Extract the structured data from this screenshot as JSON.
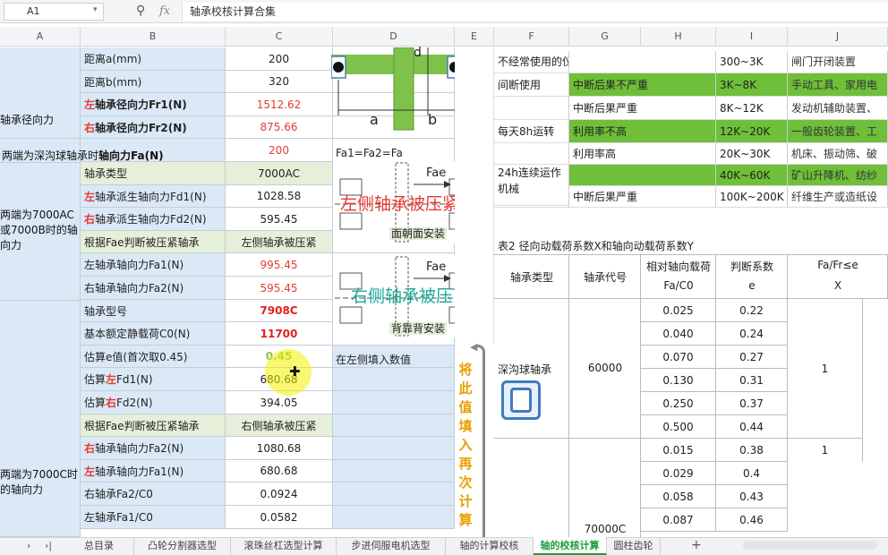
{
  "formula_bar": {
    "cell_ref": "A1",
    "fx": "fx",
    "content": "轴承校核计算合集"
  },
  "columns": [
    "A",
    "B",
    "C",
    "D",
    "E",
    "F",
    "G",
    "H",
    "I",
    "J"
  ],
  "left": {
    "a_labels": [
      "轴承径向力",
      "两端为深沟球轴承时轴向力Fa(N)",
      "两端为7000AC或7000B时的轴向力",
      "两端为7000C时的轴向力"
    ],
    "rows": [
      {
        "label_pre": "",
        "label_accent": "",
        "label_post": "距离a(mm)",
        "value": "200"
      },
      {
        "label_pre": "",
        "label_accent": "",
        "label_post": "距离b(mm)",
        "value": "320"
      },
      {
        "label_pre": "",
        "label_accent": "左",
        "label_post": "轴承径向力Fr1(N)",
        "value": "1512.62"
      },
      {
        "label_pre": "",
        "label_accent": "右",
        "label_post": "轴承径向力Fr2(N)",
        "value": "875.66"
      },
      {
        "label_pre": "",
        "label_accent": "",
        "label_post": "",
        "value": "200"
      },
      {
        "label_pre": "",
        "label_accent": "",
        "label_post": "轴承类型",
        "value": "7000AC"
      },
      {
        "label_pre": "",
        "label_accent": "左",
        "label_post": "轴承派生轴向力Fd1(N)",
        "value": "1028.58"
      },
      {
        "label_pre": "",
        "label_accent": "右",
        "label_post": "轴承派生轴向力Fd2(N)",
        "value": "595.45"
      },
      {
        "label_pre": "",
        "label_accent": "",
        "label_post": "根据Fae判断被压紧轴承",
        "value": "左侧轴承被压紧"
      },
      {
        "label_pre": "",
        "label_accent": "",
        "label_post": "左轴承轴向力Fa1(N)",
        "value": "995.45"
      },
      {
        "label_pre": "",
        "label_accent": "",
        "label_post": "右轴承轴向力Fa2(N)",
        "value": "595.45"
      },
      {
        "label_pre": "",
        "label_accent": "",
        "label_post": "轴承型号",
        "value": "7908C"
      },
      {
        "label_pre": "",
        "label_accent": "",
        "label_post": "基本额定静载荷C0(N)",
        "value": "11700"
      },
      {
        "label_pre": "",
        "label_accent": "",
        "label_post": "估算e值(首次取0.45)",
        "value": "0.45"
      },
      {
        "label_pre": "估算",
        "label_accent": "左",
        "label_post": "Fd1(N)",
        "value": "680.68"
      },
      {
        "label_pre": "估算",
        "label_accent": "右",
        "label_post": "Fd2(N)",
        "value": "394.05"
      },
      {
        "label_pre": "",
        "label_accent": "",
        "label_post": "根据Fae判断被压紧轴承",
        "value": "右侧轴承被压紧"
      },
      {
        "label_pre": "",
        "label_accent": "右",
        "label_post": "轴承轴向力Fa2(N)",
        "value": "1080.68"
      },
      {
        "label_pre": "",
        "label_accent": "左",
        "label_post": "轴承轴向力Fa1(N)",
        "value": "680.68"
      },
      {
        "label_pre": "",
        "label_accent": "",
        "label_post": "右轴承Fa2/C0",
        "value": "0.0924"
      },
      {
        "label_pre": "",
        "label_accent": "",
        "label_post": "左轴承Fa1/C0",
        "value": "0.0582"
      }
    ],
    "d_texts": {
      "a": "a",
      "b": "b",
      "dim": "d",
      "eq": "Fa1=Fa2=Fa",
      "fae1": "Fae",
      "fae2": "Fae",
      "overlay1": "左侧轴承被压紧",
      "mount1": "面朝面安装",
      "overlay2": "右侧轴承被压紧",
      "mount2": "背靠背安装",
      "fill_hint": "在左侧填入数值",
      "vertical_note": "将此值填入再次计算"
    }
  },
  "right": {
    "top_rows": [
      {
        "f": "不经常使用的仪器和设备",
        "g": "",
        "i": "300~3K",
        "j": "闸门开闭装置"
      },
      {
        "f": "间断使用",
        "g": "中断后果不严重",
        "i": "3K~8K",
        "j": "手动工具、家用电"
      },
      {
        "f": "",
        "g": "中断后果严重",
        "i": "8K~12K",
        "j": "发动机辅助装置、"
      },
      {
        "f": "每天8h运转",
        "g": "利用率不高",
        "i": "12K~20K",
        "j": "一般齿轮装置、工"
      },
      {
        "f": "",
        "g": "利用率高",
        "i": "20K~30K",
        "j": "机床、振动筛、破"
      },
      {
        "f": "24h连续运作机械",
        "g": "",
        "i": "40K~60K",
        "j": "矿山升降机、纺纱"
      },
      {
        "f": "",
        "g": "中断后果严重",
        "i": "100K~200K",
        "j": "纤维生产或造纸设"
      }
    ],
    "table2_title": "表2 径向动载荷系数X和轴向动载荷系数Y",
    "headers": {
      "type": "轴承类型",
      "code": "轴承代号",
      "rel1": "相对轴向载荷",
      "rel2": "Fa/C0",
      "e1": "判断系数",
      "e2": "e",
      "group": "Fa/Fr≤e",
      "x": "X"
    },
    "deep_groove": {
      "name": "深沟球轴承",
      "code": "60000",
      "rows": [
        [
          "0.025",
          "0.22"
        ],
        [
          "0.040",
          "0.24"
        ],
        [
          "0.070",
          "0.27"
        ],
        [
          "0.130",
          "0.31"
        ],
        [
          "0.250",
          "0.37"
        ],
        [
          "0.500",
          "0.44"
        ]
      ],
      "x": "1"
    },
    "angular": {
      "code": "70000C",
      "rows": [
        [
          "0.015",
          "0.38"
        ],
        [
          "0.029",
          "0.4"
        ],
        [
          "0.058",
          "0.43"
        ],
        [
          "0.087",
          "0.46"
        ]
      ],
      "x": "1"
    }
  },
  "tabs": [
    "总目录",
    "凸轮分割器选型",
    "滚珠丝杠选型计算",
    "步进伺服电机选型",
    "轴的计算校核",
    "轴的校核计算",
    "圆柱齿轮"
  ],
  "active_tab": 5,
  "colors": {
    "green_band": "#6fbf3a",
    "blue_cell": "#dbe9f6",
    "red_text": "#e53935",
    "highlight": "#f2f200"
  }
}
